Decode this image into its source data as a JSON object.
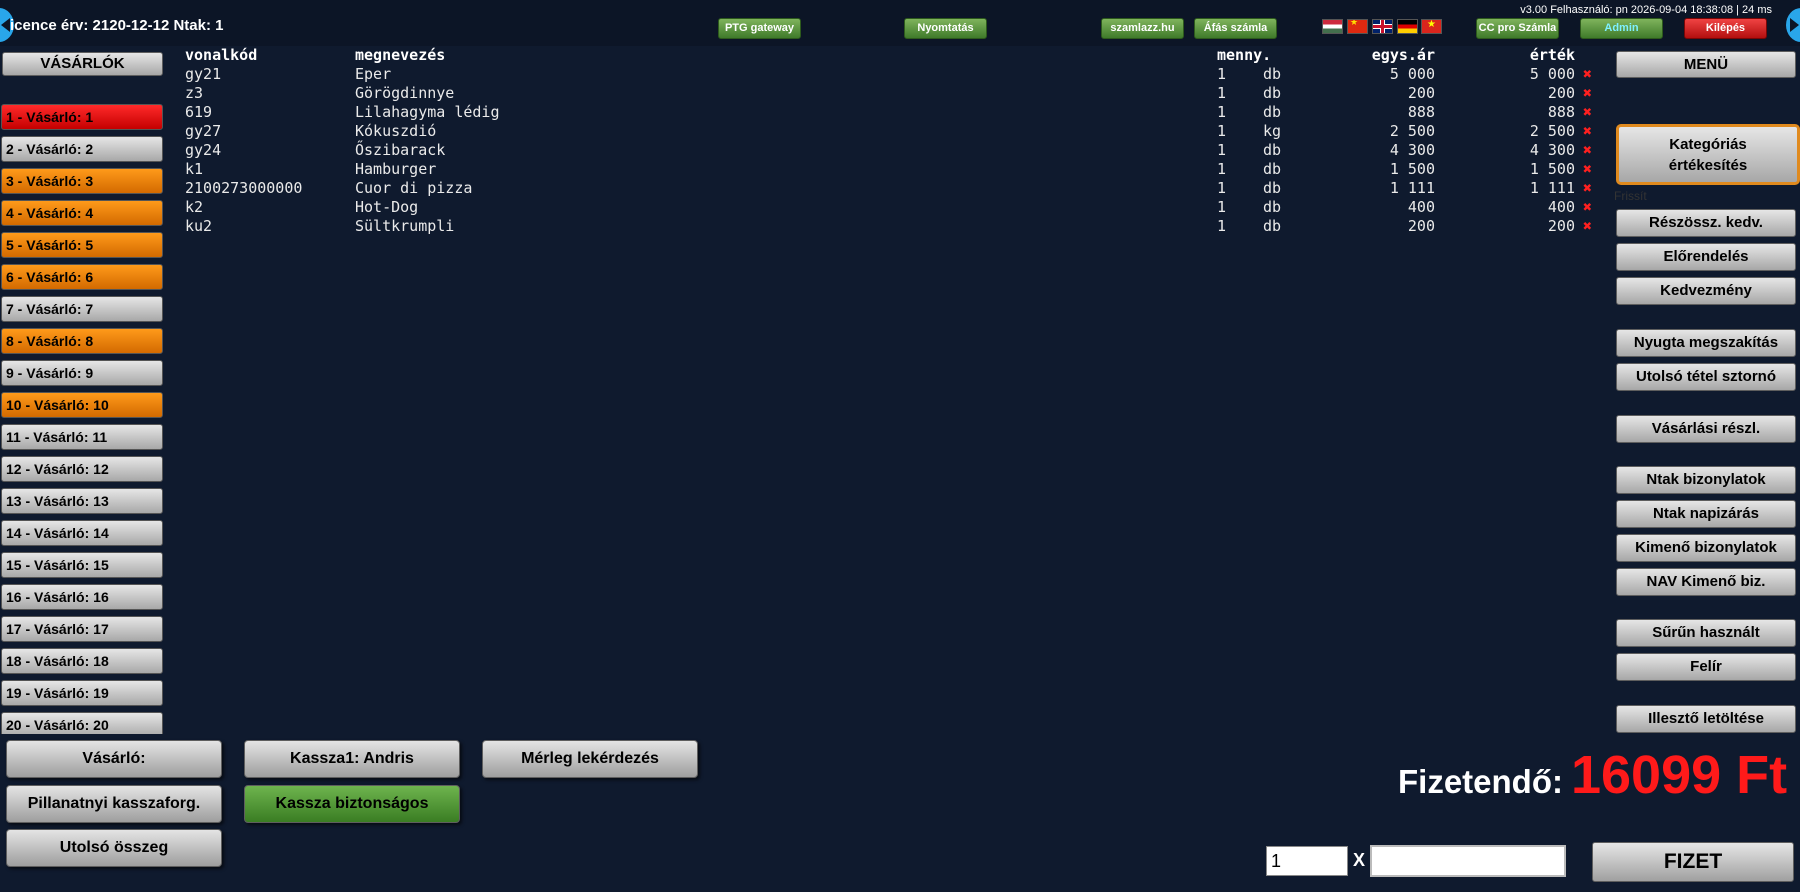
{
  "topbar": {
    "licence": "icence érv: 2120-12-12 Ntak: 1",
    "version": "v3.00 Felhasználó: pn 2026-09-04 18:38:08 | 24 ms",
    "buttons": {
      "ptg": "PTG gateway",
      "print": "Nyomtatás",
      "szamlazz": "szamlazz.hu",
      "afas": "Áfás számla",
      "ccpro": "CC pro Számla",
      "admin": "Admin",
      "exit": "Kilépés"
    },
    "flags": [
      "hu-flag-icon",
      "cn-flag-icon",
      "uk-flag-icon",
      "de-flag-icon",
      "vn-flag-icon"
    ]
  },
  "customers": {
    "header": "VÁSÁRLÓK",
    "items": [
      {
        "label": "1 - Vásárló: 1",
        "status": "red"
      },
      {
        "label": "2 - Vásárló: 2",
        "status": "gray"
      },
      {
        "label": "3 - Vásárló: 3",
        "status": "orange"
      },
      {
        "label": "4 - Vásárló: 4",
        "status": "orange"
      },
      {
        "label": "5 - Vásárló: 5",
        "status": "orange"
      },
      {
        "label": "6 - Vásárló: 6",
        "status": "orange"
      },
      {
        "label": "7 - Vásárló: 7",
        "status": "gray"
      },
      {
        "label": "8 - Vásárló: 8",
        "status": "orange"
      },
      {
        "label": "9 - Vásárló: 9",
        "status": "gray"
      },
      {
        "label": "10 - Vásárló: 10",
        "status": "orange"
      },
      {
        "label": "11 - Vásárló: 11",
        "status": "gray"
      },
      {
        "label": "12 - Vásárló: 12",
        "status": "gray"
      },
      {
        "label": "13 - Vásárló: 13",
        "status": "gray"
      },
      {
        "label": "14 - Vásárló: 14",
        "status": "gray"
      },
      {
        "label": "15 - Vásárló: 15",
        "status": "gray"
      },
      {
        "label": "16 - Vásárló: 16",
        "status": "gray"
      },
      {
        "label": "17 - Vásárló: 17",
        "status": "gray"
      },
      {
        "label": "18 - Vásárló: 18",
        "status": "gray"
      },
      {
        "label": "19 - Vásárló: 19",
        "status": "gray"
      },
      {
        "label": "20 - Vásárló: 20",
        "status": "gray"
      }
    ]
  },
  "table": {
    "headers": {
      "code": "vonalkód",
      "name": "megnevezés",
      "qty": "menny.",
      "price": "egys.ár",
      "value": "érték"
    },
    "rows": [
      {
        "code": "gy21",
        "name": "Eper",
        "qty": "1",
        "unit": "db",
        "price": "5 000",
        "value": "5 000"
      },
      {
        "code": "z3",
        "name": "Görögdinnye",
        "qty": "1",
        "unit": "db",
        "price": "200",
        "value": "200"
      },
      {
        "code": "619",
        "name": "Lilahagyma lédig",
        "qty": "1",
        "unit": "db",
        "price": "888",
        "value": "888"
      },
      {
        "code": "gy27",
        "name": "Kókuszdió",
        "qty": "1",
        "unit": "kg",
        "price": "2 500",
        "value": "2 500"
      },
      {
        "code": "gy24",
        "name": "Őszibarack",
        "qty": "1",
        "unit": "db",
        "price": "4 300",
        "value": "4 300"
      },
      {
        "code": "k1",
        "name": "Hamburger",
        "qty": "1",
        "unit": "db",
        "price": "1 500",
        "value": "1 500"
      },
      {
        "code": "2100273000000",
        "name": "Cuor di pizza",
        "qty": "1",
        "unit": "db",
        "price": "1 111",
        "value": "1 111"
      },
      {
        "code": "k2",
        "name": "Hot-Dog",
        "qty": "1",
        "unit": "db",
        "price": "400",
        "value": "400"
      },
      {
        "code": "ku2",
        "name": "Sültkrumpli",
        "qty": "1",
        "unit": "db",
        "price": "200",
        "value": "200"
      }
    ],
    "delete_glyph": "✖"
  },
  "menu": {
    "header": "MENÜ",
    "category_line1": "Kategóriás",
    "category_line2": "értékesítés",
    "refresh": "Frissít",
    "items": {
      "partial": "Részössz. kedv.",
      "preorder": "Előrendelés",
      "discount": "Kedvezmény",
      "receipt_cancel": "Nyugta megszakítás",
      "last_storno": "Utolsó tétel sztornó",
      "purchase_details": "Vásárlási részl.",
      "ntak_docs": "Ntak bizonylatok",
      "ntak_daily": "Ntak napizárás",
      "outgoing_docs": "Kimenő bizonylatok",
      "nav_outgoing": "NAV Kimenő biz.",
      "frequent": "Sűrűn használt",
      "upload": "Felír",
      "driver_download": "Illesztő letöltése"
    }
  },
  "bottom": {
    "customer_btn": "Vásárló:",
    "cashier_btn": "Kassza1: Andris",
    "scale_btn": "Mérleg lekérdezés",
    "cash_flow_btn": "Pillanatnyi kasszaforg.",
    "safe_btn": "Kassza biztonságos",
    "last_total_btn": "Utolsó összeg",
    "payable_label": "Fizetendő:",
    "payable_amount": "16099 Ft",
    "qty_value": "1",
    "x_label": "X",
    "code_value": "",
    "pay_btn": "FIZET"
  }
}
